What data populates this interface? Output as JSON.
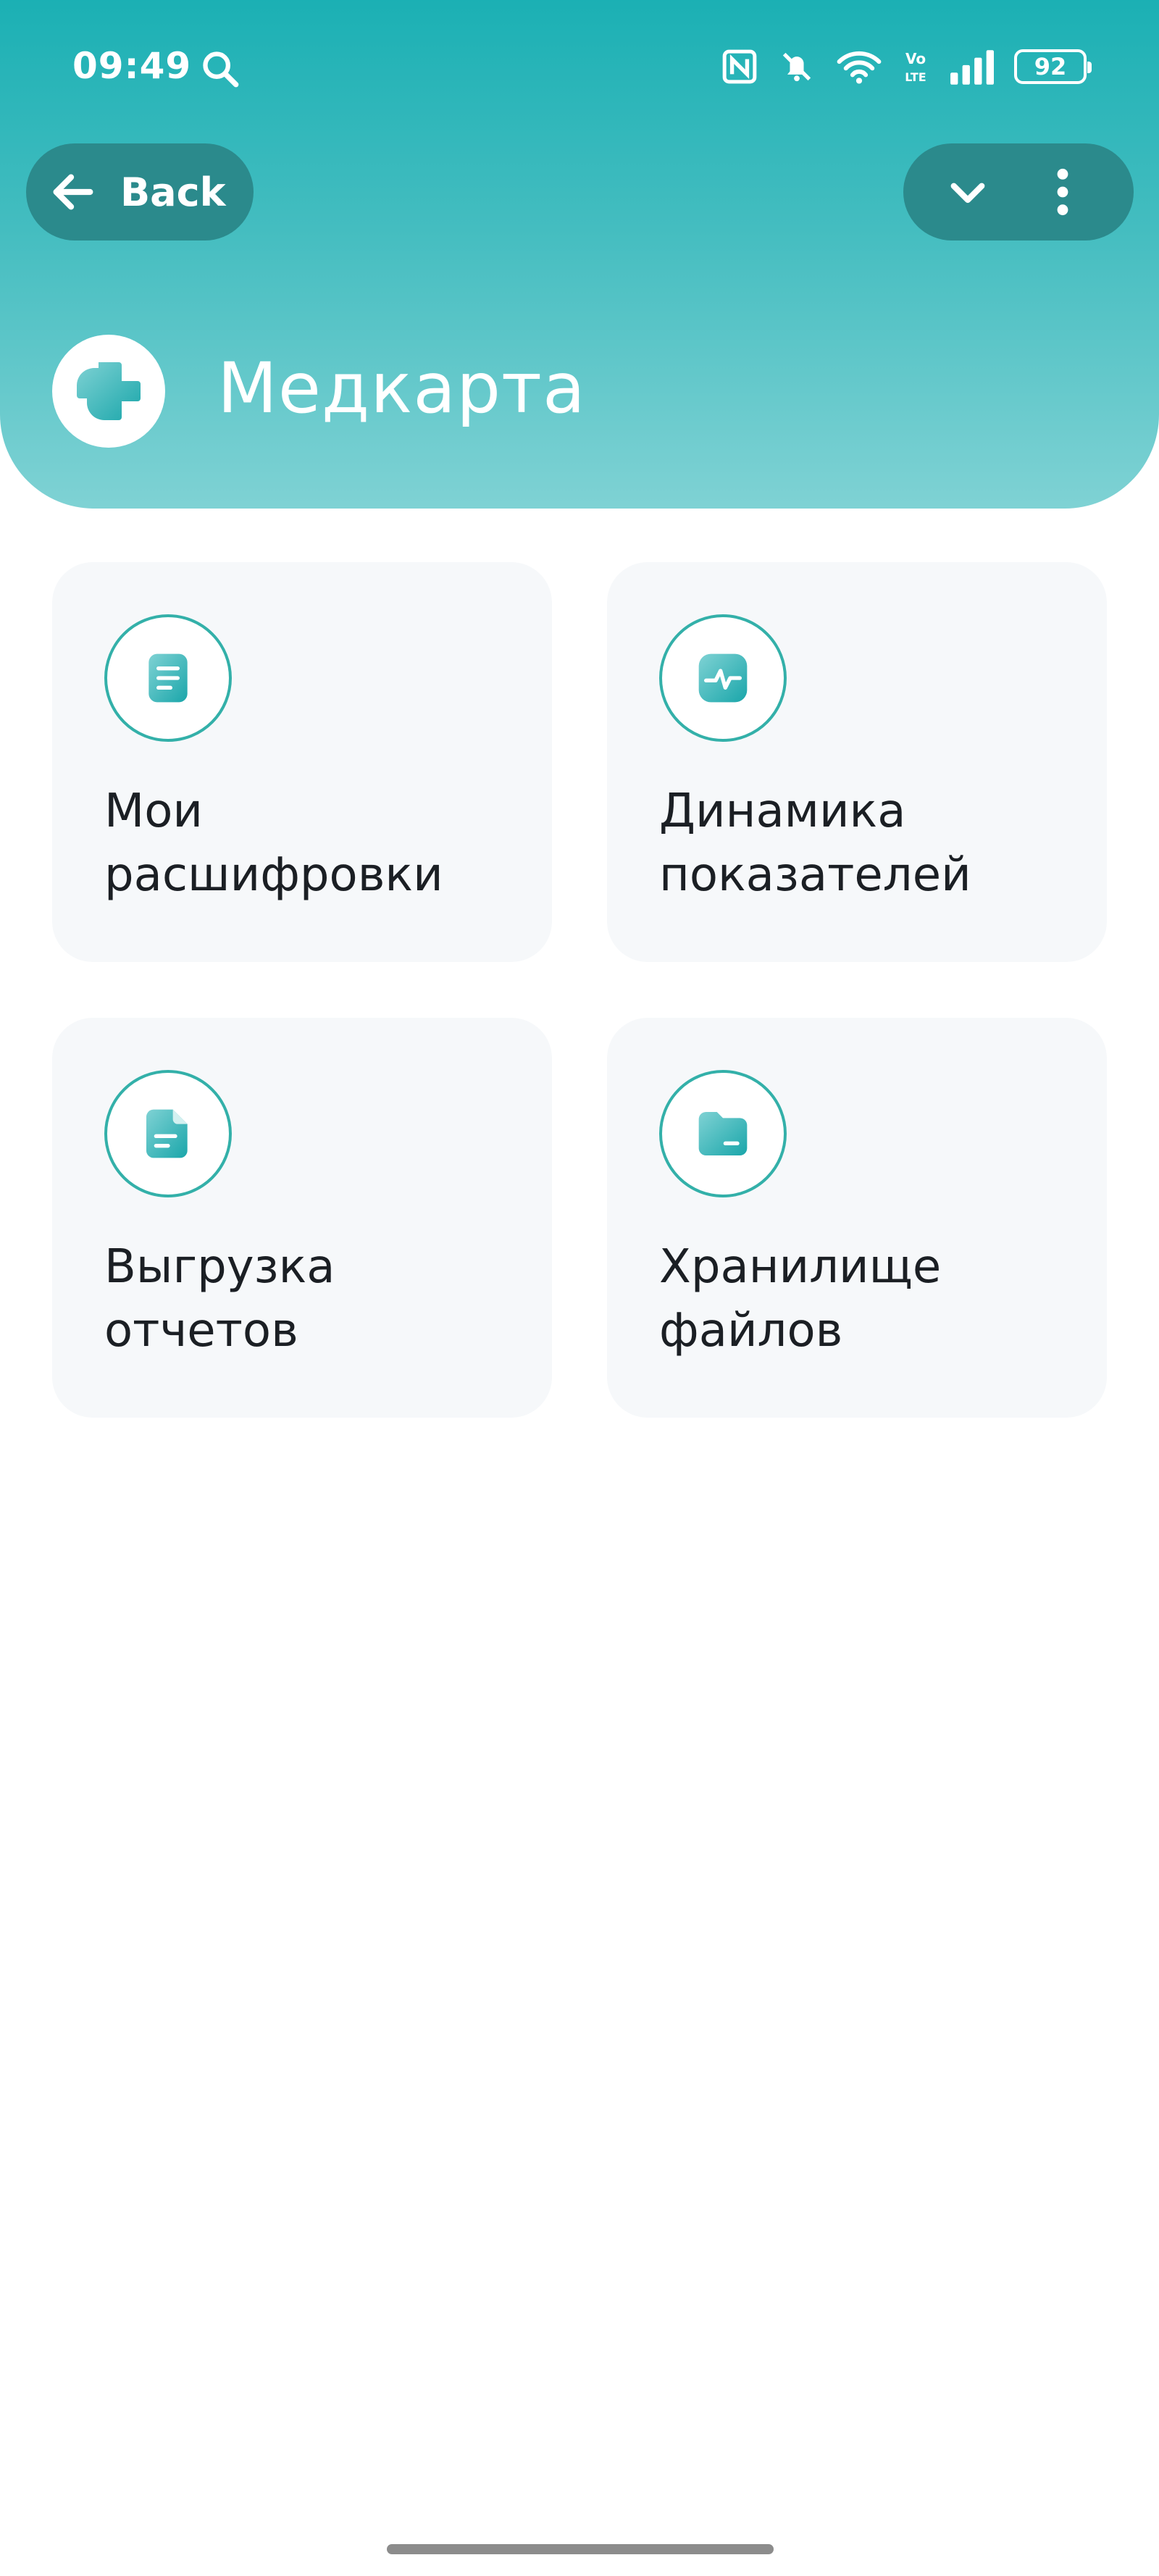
{
  "status_bar": {
    "time": "09:49",
    "network_label_top": "Vo",
    "network_label_bottom": "LTE",
    "battery_level": "92"
  },
  "header": {
    "back_label": "Back",
    "title": "Медкарта",
    "gradient_top": "#1bb0b4",
    "gradient_bottom": "#7fd2d4",
    "accent": "#2b8a8c"
  },
  "tiles": [
    {
      "label": "Мои\nрасшифровки",
      "icon": "document-list-icon"
    },
    {
      "label": "Динамика\nпоказателей",
      "icon": "pulse-chart-icon"
    },
    {
      "label": "Выгрузка\nотчетов",
      "icon": "report-file-icon"
    },
    {
      "label": "Хранилище\nфайлов",
      "icon": "folder-icon"
    }
  ]
}
